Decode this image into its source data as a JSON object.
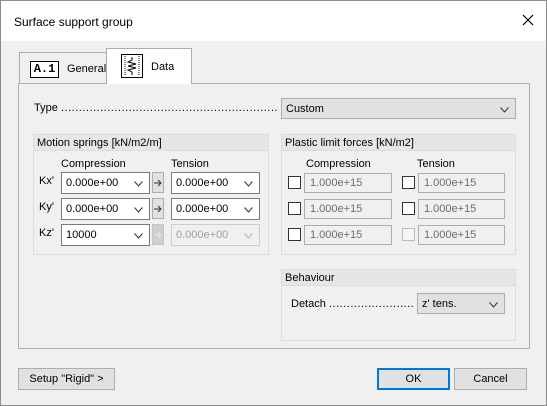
{
  "window": {
    "title": "Surface support group"
  },
  "tabs": [
    {
      "label": "General",
      "icon_text": "A.1"
    },
    {
      "label": "Data"
    }
  ],
  "type_row": {
    "label": "Type",
    "value": "Custom"
  },
  "motion_springs": {
    "title": "Motion springs [kN/m2/m]",
    "compression_header": "Compression",
    "tension_header": "Tension",
    "rows": [
      {
        "label": "Kx'",
        "compression": "0.000e+00",
        "tension": "0.000e+00",
        "tension_enabled": true
      },
      {
        "label": "Ky'",
        "compression": "0.000e+00",
        "tension": "0.000e+00",
        "tension_enabled": true
      },
      {
        "label": "Kz'",
        "compression": "10000",
        "tension": "0.000e+00",
        "tension_enabled": false
      }
    ]
  },
  "plastic_limit": {
    "title": "Plastic limit forces [kN/m2]",
    "compression_header": "Compression",
    "tension_header": "Tension",
    "rows": [
      {
        "compression": "1.000e+15",
        "tension": "1.000e+15",
        "compression_checked": false,
        "tension_checked": false
      },
      {
        "compression": "1.000e+15",
        "tension": "1.000e+15",
        "compression_checked": false,
        "tension_checked": false
      },
      {
        "compression": "1.000e+15",
        "tension": "1.000e+15",
        "compression_checked": false,
        "tension_checked": false
      }
    ]
  },
  "behaviour": {
    "title": "Behaviour",
    "detach_label": "Detach",
    "detach_value": "z' tens."
  },
  "footer": {
    "setup_rigid_label": "Setup \"Rigid\" >",
    "ok_label": "OK",
    "cancel_label": "Cancel"
  }
}
